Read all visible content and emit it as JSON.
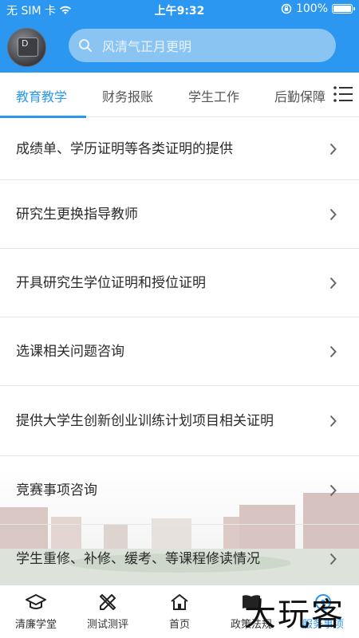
{
  "status_bar": {
    "carrier": "无 SIM 卡",
    "time": "上午9:32",
    "battery": "100%"
  },
  "header": {
    "avatar_key": "D",
    "search_placeholder": "风清气正月更明"
  },
  "tabs": [
    {
      "label": "教育教学",
      "active": true
    },
    {
      "label": "财务报账",
      "active": false
    },
    {
      "label": "学生工作",
      "active": false
    },
    {
      "label": "后勤保障",
      "active": false
    }
  ],
  "items": [
    {
      "label": "成绩单、学历证明等各类证明的提供"
    },
    {
      "label": "研究生更换指导教师"
    },
    {
      "label": "开具研究生学位证明和授位证明"
    },
    {
      "label": "选课相关问题咨询"
    },
    {
      "label": "提供大学生创新创业训练计划项目相关证明"
    },
    {
      "label": "竞赛事项咨询"
    },
    {
      "label": "学生重修、补修、缓考、等课程修读情况"
    }
  ],
  "tabbar": [
    {
      "label": "清廉学堂",
      "icon": "graduation-cap-icon",
      "active": false
    },
    {
      "label": "测试测评",
      "icon": "pencil-ruler-icon",
      "active": false
    },
    {
      "label": "首页",
      "icon": "home-icon",
      "active": false
    },
    {
      "label": "政策法规",
      "icon": "book-icon",
      "active": false
    },
    {
      "label": "服务事项",
      "icon": "service-icon",
      "active": true
    }
  ],
  "watermark": "大玩客",
  "colors": {
    "primary": "#2b97f0",
    "search_bg": "#8ac4f3"
  }
}
